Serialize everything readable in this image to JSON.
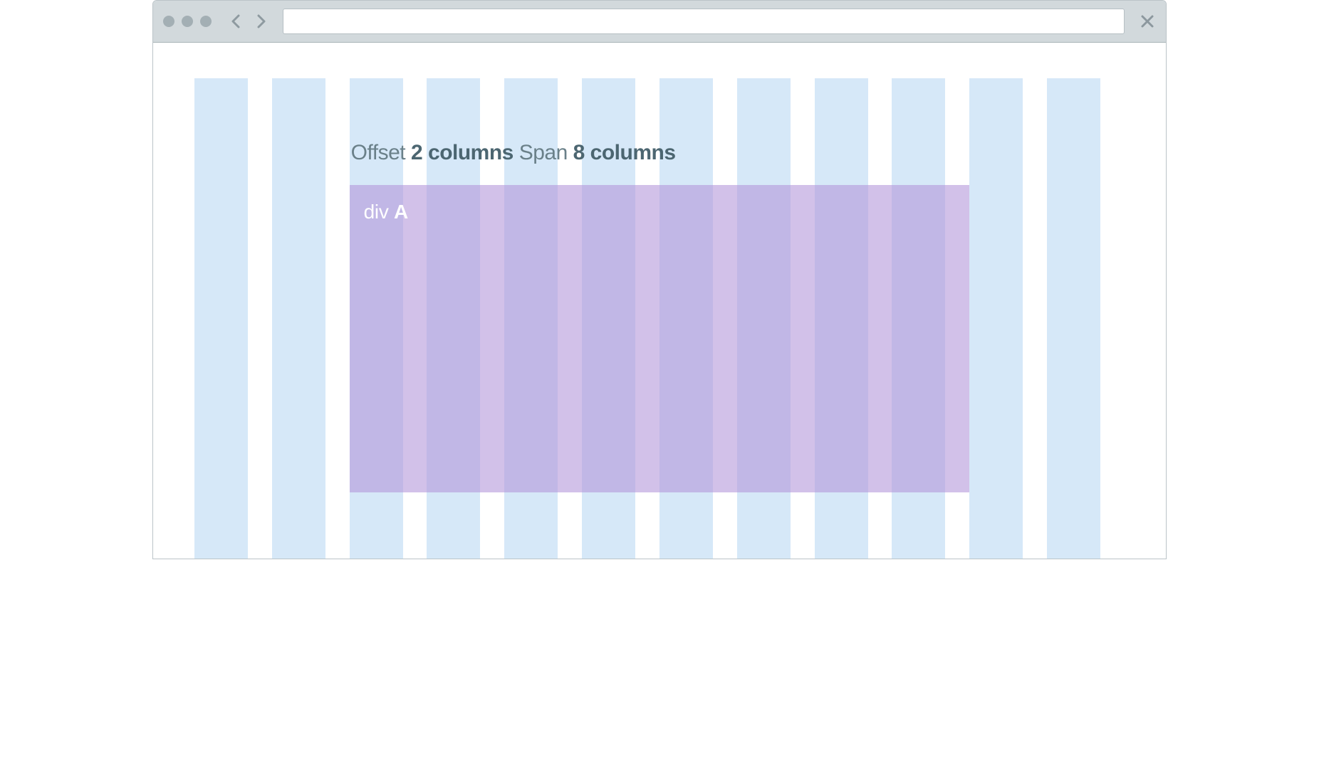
{
  "heading": {
    "offset_label": "Offset",
    "offset_value": "2 columns",
    "span_label": "Span",
    "span_value": "8 columns"
  },
  "box": {
    "prefix": "div",
    "name": "A"
  },
  "grid": {
    "columns": 12,
    "offset": 2,
    "span": 8
  }
}
